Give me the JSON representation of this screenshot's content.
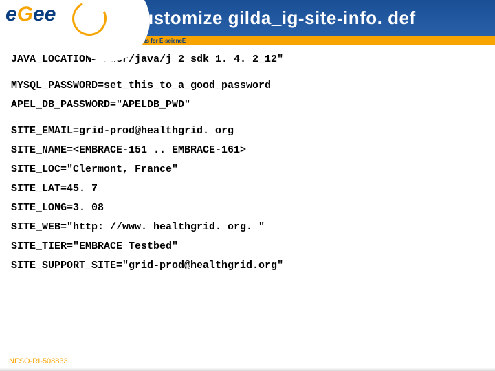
{
  "header": {
    "logo_e1": "e",
    "logo_g": "G",
    "logo_e2": "e",
    "logo_e3": "e",
    "title": "Customize gilda_ig-site-info. def",
    "subtitle": "Enabling Grids for E-sciencE"
  },
  "lines": {
    "l1": "JAVA_LOCATION=\"/usr/java/j 2 sdk 1. 4. 2_12\"",
    "l2": "MYSQL_PASSWORD=set_this_to_a_good_password",
    "l3": "APEL_DB_PASSWORD=\"APELDB_PWD\"",
    "l4": "SITE_EMAIL=grid-prod@healthgrid. org",
    "l5": "SITE_NAME=<EMBRACE-151 .. EMBRACE-161>",
    "l6": "SITE_LOC=\"Clermont, France\"",
    "l7": "SITE_LAT=45. 7",
    "l8": "SITE_LONG=3. 08",
    "l9": "SITE_WEB=\"http: //www. healthgrid. org. \"",
    "l10": "SITE_TIER=\"EMBRACE Testbed\"",
    "l11": "SITE_SUPPORT_SITE=\"grid-prod@healthgrid.org\""
  },
  "footer": "INFSO-RI-508833"
}
